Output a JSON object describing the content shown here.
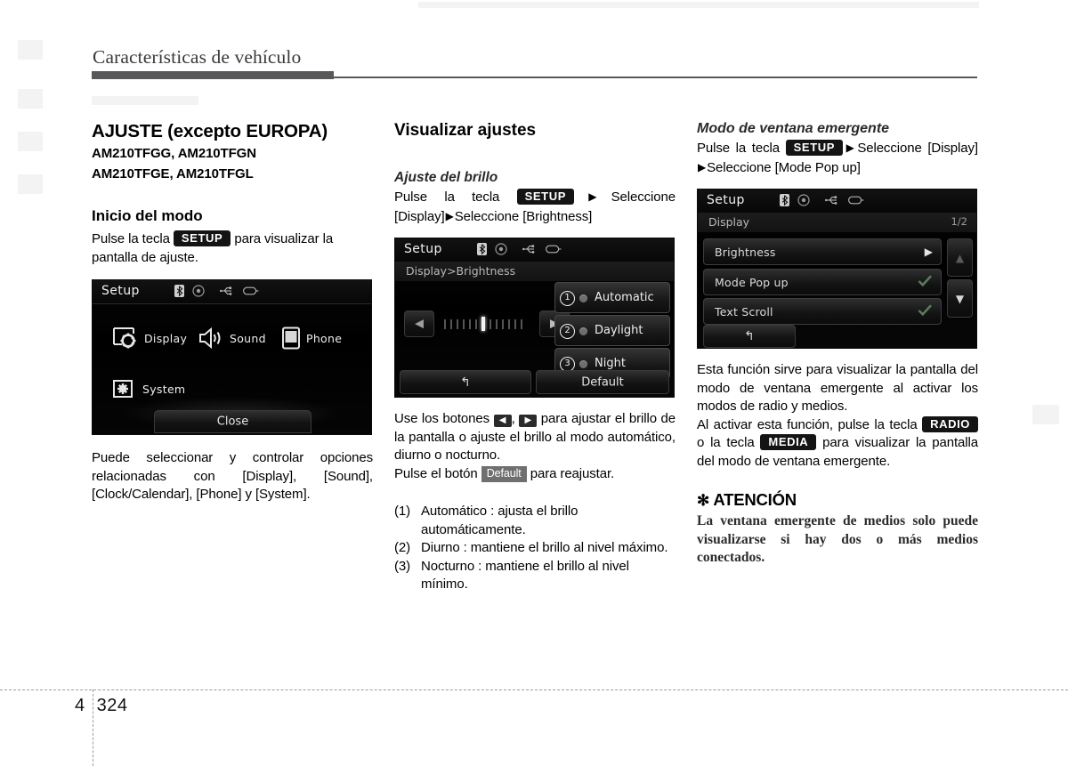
{
  "page": {
    "header_title": "Características de vehículo",
    "chapter": "4",
    "folio": "324"
  },
  "col1": {
    "section_title": "AJUSTE (excepto EUROPA)",
    "model_line_1": "AM210TFGG, AM210TFGN",
    "model_line_2": "AM210TFGE, AM210TFGL",
    "sub_title": "Inicio del modo",
    "intro_before": "Pulse la tecla",
    "intro_key": "SETUP",
    "intro_after": "para visualizar la pantalla de ajuste.",
    "caption": "Puede seleccionar y controlar opciones relacionadas con [Display], [Sound], [Clock/Calendar], [Phone] y [System].",
    "screen": {
      "title": "Setup",
      "items": [
        {
          "label": "Display",
          "icon": "display-gear-icon"
        },
        {
          "label": "Sound",
          "icon": "speaker-icon"
        },
        {
          "label": "Phone",
          "icon": "phone-icon"
        },
        {
          "label": "System",
          "icon": "system-gear-icon"
        }
      ],
      "close_label": "Close"
    }
  },
  "col2": {
    "section_title": "Visualizar ajustes",
    "italic_title": "Ajuste del brillo",
    "path_before": "Pulse la tecla",
    "path_key": "SETUP",
    "path_mid": "Seleccione [Display]",
    "path_end": "Seleccione [Brightness]",
    "screen": {
      "title": "Setup",
      "breadcrumb": "Display>Brightness",
      "options": [
        {
          "num": "1",
          "label": "Automatic"
        },
        {
          "num": "2",
          "label": "Daylight"
        },
        {
          "num": "3",
          "label": "Night"
        }
      ],
      "slider_ticks": 13,
      "slider_active_index": 6,
      "back_icon": "back-arrow-icon",
      "default_label": "Default"
    },
    "body_1a": "Use los botones",
    "body_1b": ",",
    "body_1c": "para ajustar el brillo de la pantalla o ajuste el brillo al modo automático, diurno o nocturno.",
    "body_2a": "Pulse el botón",
    "body_2key": "Default",
    "body_2b": "para reajustar.",
    "list": [
      {
        "lead": "(1)",
        "text": "Automático : ajusta el brillo automáticamente."
      },
      {
        "lead": "(2)",
        "text": "Diurno : mantiene el brillo al nivel máximo."
      },
      {
        "lead": "(3)",
        "text": "Nocturno : mantiene el brillo al nivel mínimo."
      }
    ]
  },
  "col3": {
    "italic_title": "Modo de ventana emergente",
    "path_before": "Pulse la tecla",
    "path_key": "SETUP",
    "path_mid": "Seleccione [Display]",
    "path_end": "Seleccione [Mode Pop up]",
    "screen": {
      "title": "Setup",
      "breadcrumb": "Display",
      "page_indicator": "1/2",
      "rows": [
        {
          "label": "Brightness",
          "glyph": "arrow-right-icon"
        },
        {
          "label": "Mode Pop up",
          "glyph": "check-icon"
        },
        {
          "label": "Text Scroll",
          "glyph": "check-icon"
        }
      ],
      "back_icon": "back-arrow-icon",
      "scroll_up_icon": "triangle-up-icon",
      "scroll_down_icon": "triangle-down-icon"
    },
    "body_1": "Esta función sirve para visualizar la pantalla del modo de ventana emergente al activar los modos de radio y medios.",
    "body_2a": "Al activar esta función, pulse la tecla",
    "body_2key1": "RADIO",
    "body_2mid": "o la tecla",
    "body_2key2": "MEDIA",
    "body_2b": "para visualizar la pantalla del modo de ventana emergente.",
    "attention_star": "✻",
    "attention_title": "ATENCIÓN",
    "attention_body": "La ventana emergente de medios solo puede visualizarse si hay dos o más medios conectados."
  }
}
